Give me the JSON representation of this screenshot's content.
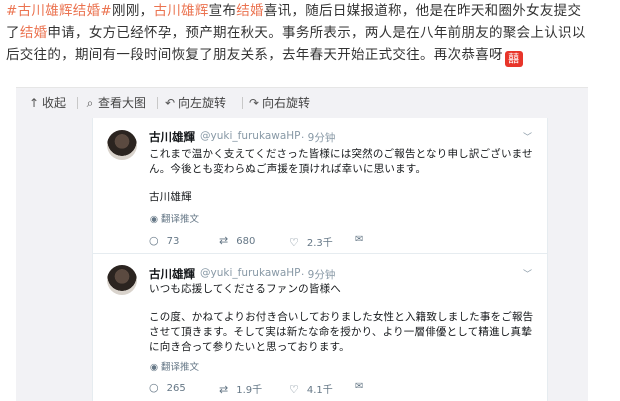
{
  "post": {
    "line1_part1": "#古川雄辉结婚#",
    "line1_part2": "刚刚，",
    "line1_part3": "古川雄辉",
    "line1_part4": "宣布",
    "line1_part5": "结婚",
    "line1_part6": "喜讯，随后日媒报道称，他是在昨天和圈外女友提交",
    "line2_part1": "了",
    "line2_part2": "结婚",
    "line2_part3": "申请，女方已经怀孕，预产期在秋天。事务所表示，两人是在八年前朋友的聚会上认识以",
    "line3_part1": "后交往的，期间有一段时间恢复了朋友关系，去年春天开始正式交往。再次恭喜呀",
    "emoji": "囍"
  },
  "toolbar": {
    "collapse": "收起",
    "view_large": "查看大图",
    "rotate_left": "向左旋转",
    "rotate_right": "向右旋转",
    "collapse_icon": "↑",
    "view_icon": "⌕",
    "rotate_left_icon": "↶",
    "rotate_right_icon": "↷"
  },
  "tweet1": {
    "name": "古川雄輝",
    "handle": "@yuki_furukawaHP",
    "time": "· 9分钟",
    "line1": "これまで温かく支えてくださった皆様には突然のご報告となり申し訳ございませ",
    "line2": "ん。今後とも変わらぬご声援を頂ければ幸いに思います。",
    "signature": "古川雄輝",
    "translate": "翻译推文",
    "replies": "73",
    "retweets": "680",
    "likes": "2.3千"
  },
  "tweet2": {
    "name": "古川雄輝",
    "handle": "@yuki_furukawaHP",
    "time": "· 9分钟",
    "subtitle": "いつも応援してくださるファンの皆様へ",
    "line1": "この度、かねてよりお付き合いしておりました女性と入籍致しました事をご報告",
    "line2": "させて頂きます。そして実は新たな命を授かり、より一層俳優として精進し真摯",
    "line3": "に向き合って参りたいと思っております。",
    "translate": "翻译推文",
    "replies": "265",
    "retweets": "1.9千",
    "likes": "4.1千"
  },
  "colors": {
    "accent": "#eb7350",
    "emoji_bg": "#e8352a",
    "media_bg": "#f2f2f5"
  }
}
